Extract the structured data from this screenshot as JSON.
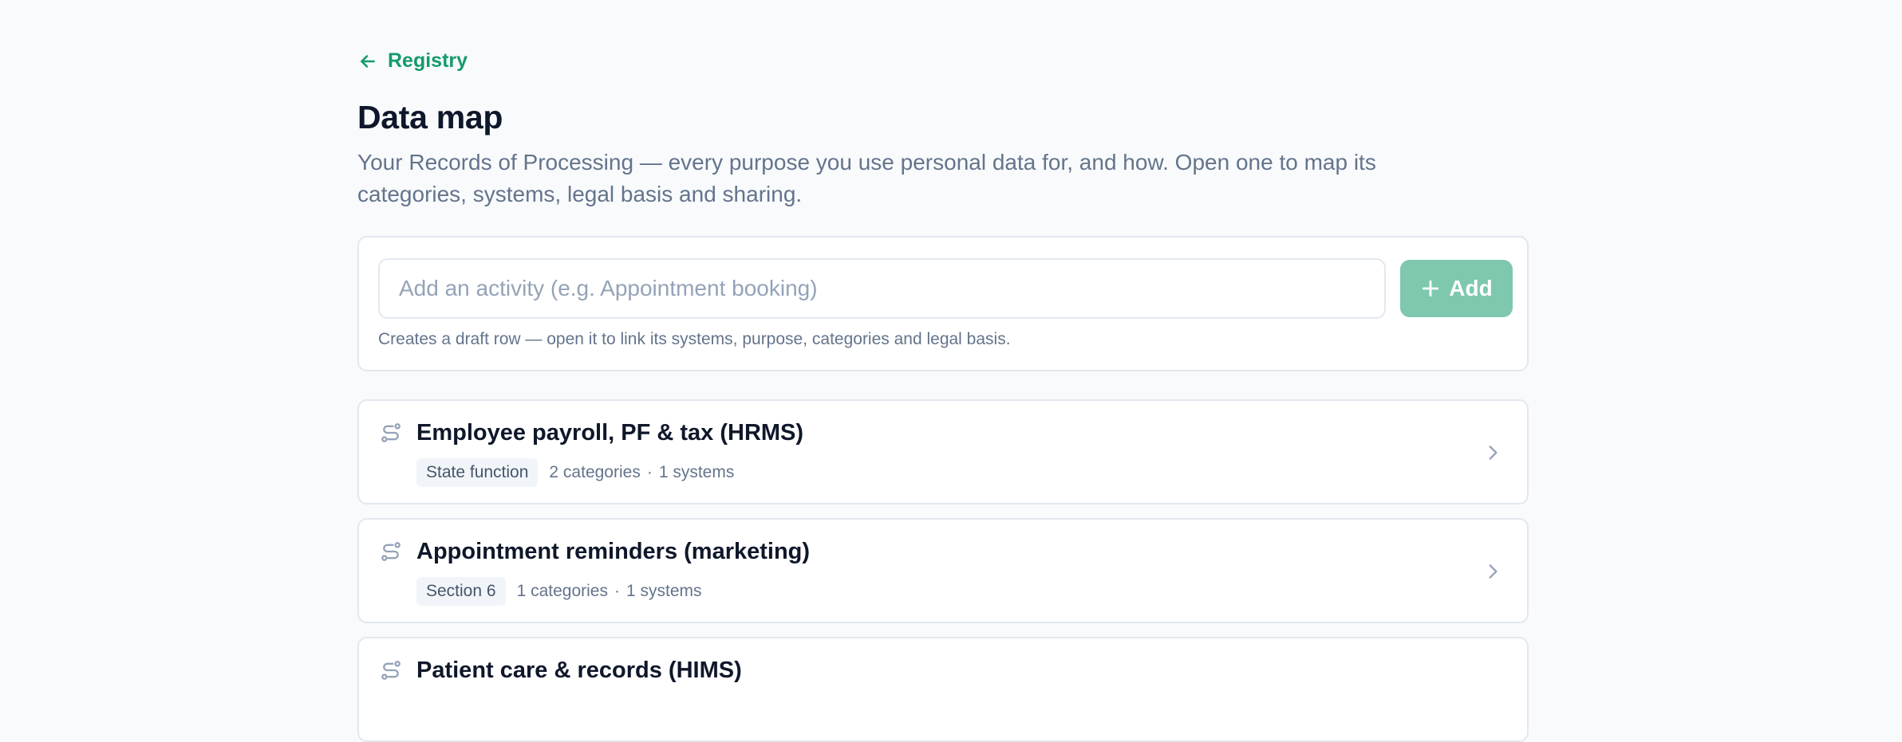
{
  "nav": {
    "back_label": "Registry"
  },
  "page": {
    "title": "Data map",
    "description": "Your Records of Processing — every purpose you use personal data for, and how. Open one to map its categories, systems, legal basis and sharing."
  },
  "add_form": {
    "placeholder": "Add an activity (e.g. Appointment booking)",
    "value": "",
    "button_label": "Add",
    "hint": "Creates a draft row — open it to link its systems, purpose, categories and legal basis."
  },
  "activities": [
    {
      "title": "Employee payroll, PF & tax (HRMS)",
      "basis": "State function",
      "categories": "2 categories",
      "systems": "1 systems"
    },
    {
      "title": "Appointment reminders (marketing)",
      "basis": "Section 6",
      "categories": "1 categories",
      "systems": "1 systems"
    },
    {
      "title": "Patient care & records (HIMS)",
      "basis": "",
      "categories": "",
      "systems": ""
    }
  ],
  "meta_separator": "·",
  "colors": {
    "accent": "#159a6c",
    "button_bg": "#7ec8ae",
    "page_bg": "#f8fafc",
    "card_border": "#e2e8f0",
    "title_text": "#0f172a",
    "muted_text": "#64748b"
  },
  "icons": {
    "back": "arrow-left-icon",
    "add": "plus-icon",
    "activity": "route-icon",
    "open": "chevron-right-icon"
  }
}
